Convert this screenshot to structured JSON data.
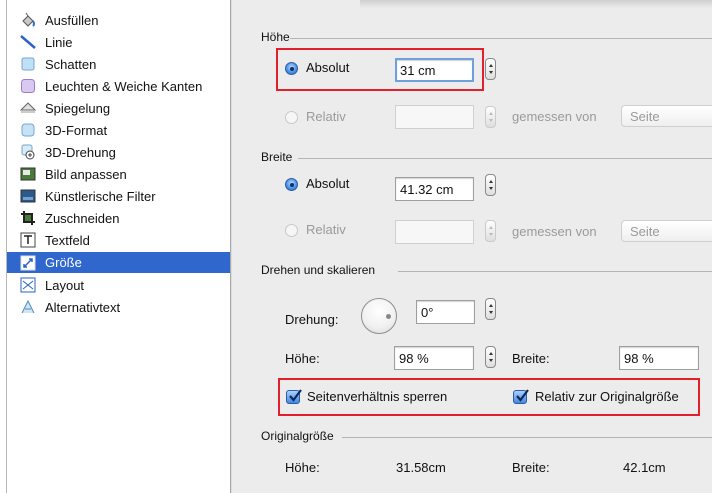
{
  "sidebar": {
    "items": [
      {
        "label": "Ausfüllen",
        "icon": "paint-bucket-icon"
      },
      {
        "label": "Linie",
        "icon": "line-icon"
      },
      {
        "label": "Schatten",
        "icon": "shadow-icon"
      },
      {
        "label": "Leuchten & Weiche Kanten",
        "icon": "glow-icon"
      },
      {
        "label": "Spiegelung",
        "icon": "reflection-icon"
      },
      {
        "label": "3D-Format",
        "icon": "3d-format-icon"
      },
      {
        "label": "3D-Drehung",
        "icon": "3d-rotation-icon"
      },
      {
        "label": "Bild anpassen",
        "icon": "picture-adjust-icon"
      },
      {
        "label": "Künstlerische Filter",
        "icon": "artistic-filter-icon"
      },
      {
        "label": "Zuschneiden",
        "icon": "crop-icon"
      },
      {
        "label": "Textfeld",
        "icon": "textbox-icon"
      },
      {
        "label": "Größe",
        "icon": "size-icon",
        "selected": true
      },
      {
        "label": "Layout",
        "icon": "layout-icon"
      },
      {
        "label": "Alternativtext",
        "icon": "alt-text-icon"
      }
    ],
    "selected_color": "#2f67cc"
  },
  "hoehe": {
    "title": "Höhe",
    "absolut_label": "Absolut",
    "absolut_value": "31 cm",
    "relativ_label": "Relativ",
    "measured_from_label": "gemessen von",
    "measured_from_value": "Seite"
  },
  "breite": {
    "title": "Breite",
    "absolut_label": "Absolut",
    "absolut_value": "41.32 cm",
    "relativ_label": "Relativ",
    "measured_from_label": "gemessen von",
    "measured_from_value": "Seite"
  },
  "rotate_scale": {
    "title": "Drehen und skalieren",
    "rotation_label": "Drehung:",
    "rotation_value": "0°",
    "height_label": "Höhe:",
    "height_value": "98 %",
    "width_label": "Breite:",
    "width_value": "98 %",
    "lock_aspect_label": "Seitenverhältnis sperren",
    "relative_original_label": "Relativ zur Originalgröße",
    "lock_aspect_checked": true,
    "relative_original_checked": true
  },
  "original": {
    "title": "Originalgröße",
    "height_label": "Höhe:",
    "height_value": "31.58cm",
    "width_label": "Breite:",
    "width_value": "42.1cm"
  },
  "colors": {
    "highlight_box": "#e2202c",
    "panel_bg": "#ececec"
  }
}
